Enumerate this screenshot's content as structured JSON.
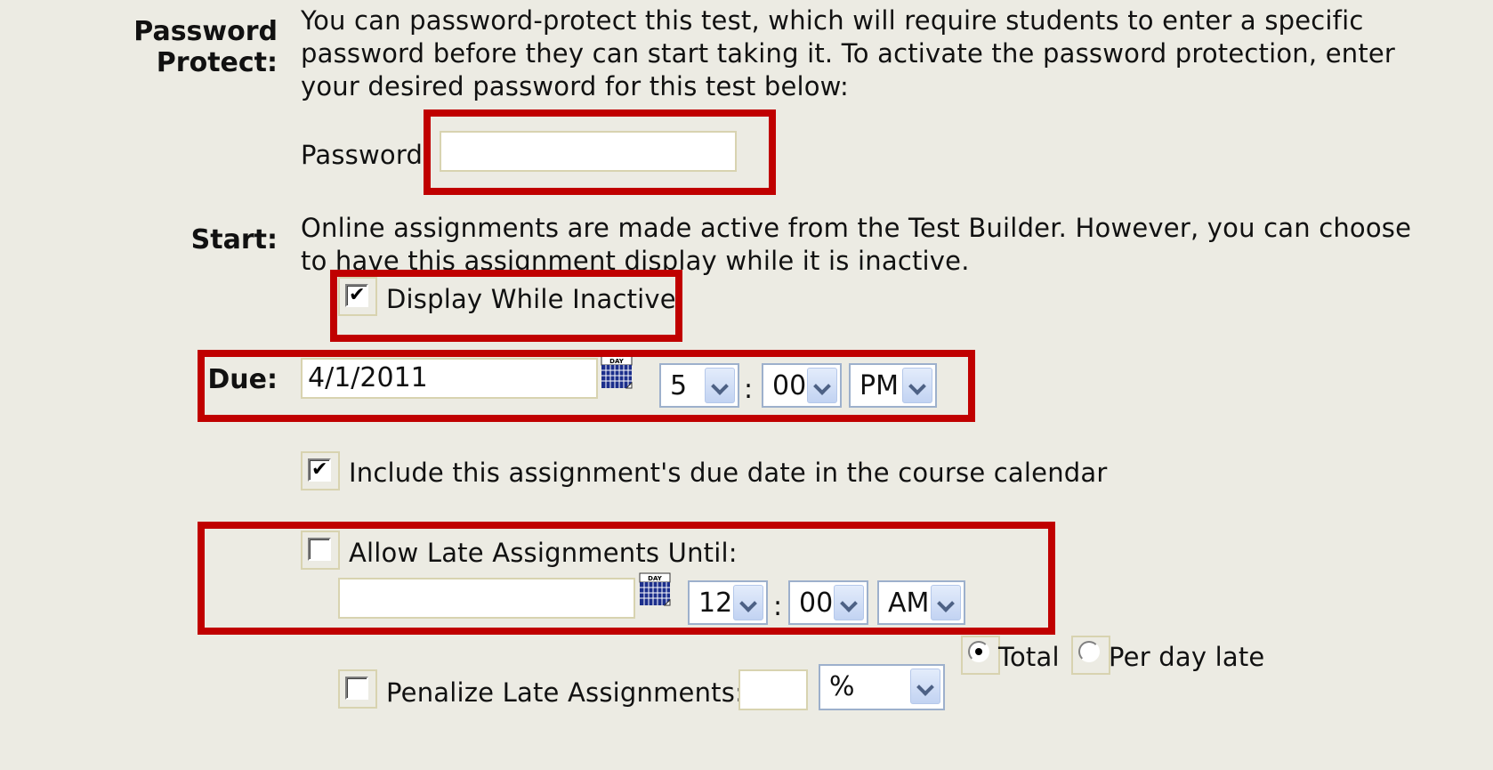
{
  "password_protect": {
    "label": "Password Protect:",
    "description_lines": [
      "You can password-protect this test, which will require students to enter a specific",
      "password before they can start taking it. To activate the password protection, enter",
      "your desired password for this test below:"
    ],
    "password_label": "Password:",
    "password_value": ""
  },
  "start": {
    "label": "Start:",
    "description_lines": [
      "Online assignments are made active from the Test Builder. However, you can choose",
      "to have this assignment display while it is inactive."
    ],
    "display_inactive_label": "Display While Inactive",
    "display_inactive_checked": true
  },
  "due": {
    "label": "Due:",
    "date_value": "4/1/2011",
    "hour": "5",
    "colon": ":",
    "minute": "00",
    "ampm": "PM",
    "calendar_icon_text": "DAY"
  },
  "calendar_include": {
    "label": "Include this assignment's due date in the course calendar",
    "checked": true
  },
  "late": {
    "allow_label": "Allow Late Assignments Until:",
    "allow_checked": false,
    "date_value": "",
    "hour": "12",
    "colon": ":",
    "minute": "00",
    "ampm": "AM",
    "calendar_icon_text": "DAY"
  },
  "penalty": {
    "label": "Penalize Late Assignments:",
    "checked": false,
    "amount_value": "",
    "unit": "%",
    "radio_total_label": "Total",
    "radio_total_selected": true,
    "radio_perday_label": "Per day late",
    "radio_perday_selected": false
  },
  "colors": {
    "background": "#ecebe3",
    "highlight": "#c00000"
  }
}
